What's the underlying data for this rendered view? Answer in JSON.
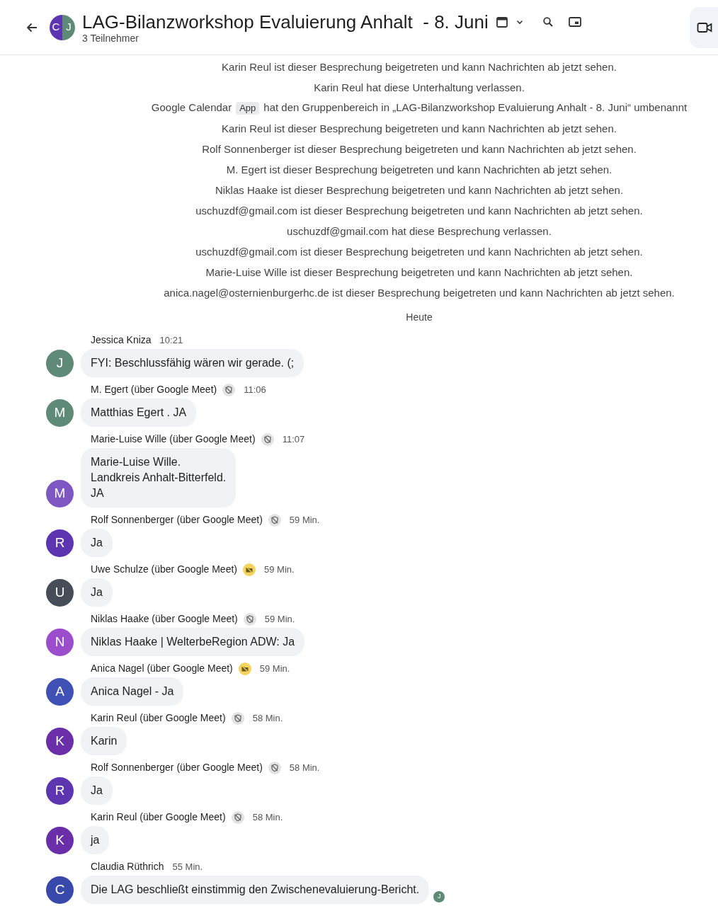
{
  "header": {
    "avatar_letters": [
      "C",
      "J"
    ],
    "title": "LAG-Bilanzworkshop Evaluierung Anhalt  - 8. Juni",
    "subtitle": "3 Teilnehmer"
  },
  "system_messages": [
    {
      "kind": "plain",
      "text": "Karin Reul ist dieser Besprechung beigetreten und kann Nachrichten ab jetzt sehen."
    },
    {
      "kind": "plain",
      "text": "Karin Reul hat diese Unterhaltung verlassen."
    },
    {
      "kind": "app",
      "before": "Google Calendar",
      "chip": "App",
      "after": "hat den Gruppenbereich in „LAG-Bilanzworkshop Evaluierung Anhalt - 8. Juni“ umbenannt"
    },
    {
      "kind": "plain",
      "text": "Karin Reul ist dieser Besprechung beigetreten und kann Nachrichten ab jetzt sehen."
    },
    {
      "kind": "plain",
      "text": "Rolf Sonnenberger ist dieser Besprechung beigetreten und kann Nachrichten ab jetzt sehen."
    },
    {
      "kind": "plain",
      "text": "M. Egert ist dieser Besprechung beigetreten und kann Nachrichten ab jetzt sehen."
    },
    {
      "kind": "plain",
      "text": "Niklas Haake ist dieser Besprechung beigetreten und kann Nachrichten ab jetzt sehen."
    },
    {
      "kind": "plain",
      "text": "uschuzdf@gmail.com ist dieser Besprechung beigetreten und kann Nachrichten ab jetzt sehen."
    },
    {
      "kind": "plain",
      "text": "uschuzdf@gmail.com hat diese Besprechung verlassen."
    },
    {
      "kind": "plain",
      "text": "uschuzdf@gmail.com ist dieser Besprechung beigetreten und kann Nachrichten ab jetzt sehen."
    },
    {
      "kind": "plain",
      "text": "Marie-Luise Wille ist dieser Besprechung beigetreten und kann Nachrichten ab jetzt sehen."
    },
    {
      "kind": "plain",
      "text": "anica.nagel@osternienburgerhc.de ist dieser Besprechung beigetreten und kann Nachrichten ab jetzt sehen."
    }
  ],
  "date_divider": "Heute",
  "messages": [
    {
      "sender": "Jessica Kniza",
      "kind": "plain",
      "time": "10:21",
      "initial": "J",
      "color": "#5f8a78",
      "lines": [
        "FYI: Beschlussfähig wären wir gerade. (;"
      ]
    },
    {
      "sender": "M. Egert (über Google Meet)",
      "kind": "shield",
      "time": "11:06",
      "initial": "M",
      "color": "#5f8a78",
      "lines": [
        "Matthias Egert . JA"
      ]
    },
    {
      "sender": "Marie-Luise Wille (über Google Meet)",
      "kind": "shield",
      "time": "11:07",
      "initial": "M",
      "color": "#7e57c2",
      "lines": [
        "Marie-Luise Wille.",
        "Landkreis Anhalt-Bitterfeld.",
        "JA"
      ]
    },
    {
      "sender": "Rolf Sonnenberger (über Google Meet)",
      "kind": "shield",
      "time": "59 Min.",
      "initial": "R",
      "color": "#5e35b1",
      "lines": [
        "Ja"
      ]
    },
    {
      "sender": "Uwe Schulze (über Google Meet)",
      "kind": "folder",
      "time": "59 Min.",
      "initial": "U",
      "color": "#474d57",
      "lines": [
        "Ja"
      ]
    },
    {
      "sender": "Niklas Haake (über Google Meet)",
      "kind": "shield",
      "time": "59 Min.",
      "initial": "N",
      "color": "#9c4dcc",
      "lines": [
        "Niklas Haake | WelterbeRegion ADW: Ja"
      ]
    },
    {
      "sender": "Anica Nagel (über Google Meet)",
      "kind": "folder",
      "time": "59 Min.",
      "initial": "A",
      "color": "#3f51b5",
      "lines": [
        "Anica Nagel - Ja"
      ]
    },
    {
      "sender": "Karin Reul (über Google Meet)",
      "kind": "shield",
      "time": "58 Min.",
      "initial": "K",
      "color": "#6a2fa8",
      "lines": [
        "Karin"
      ]
    },
    {
      "sender": "Rolf Sonnenberger (über Google Meet)",
      "kind": "shield",
      "time": "58 Min.",
      "initial": "R",
      "color": "#5e35b1",
      "lines": [
        "Ja"
      ]
    },
    {
      "sender": "Karin Reul (über Google Meet)",
      "kind": "shield",
      "time": "58 Min.",
      "initial": "K",
      "color": "#6a2fa8",
      "lines": [
        "ja"
      ]
    },
    {
      "sender": "Claudia Rüthrich",
      "kind": "plain",
      "time": "55 Min.",
      "initial": "C",
      "color": "#3949ab",
      "lines": [
        "Die LAG beschließt einstimmig den Zwischenevaluierung-Bericht."
      ],
      "read_by": "J"
    }
  ]
}
